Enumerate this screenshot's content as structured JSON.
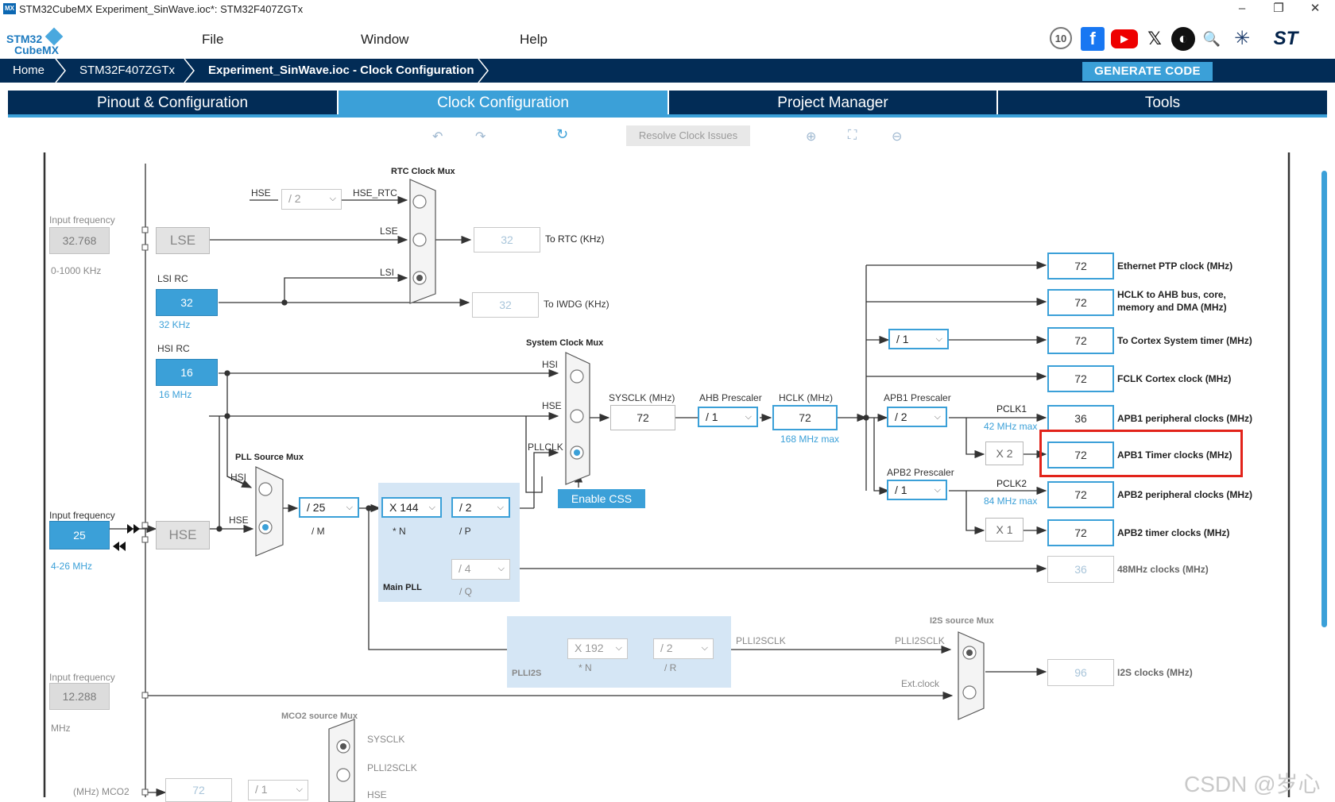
{
  "window": {
    "title": "STM32CubeMX Experiment_SinWave.ioc*: STM32F407ZGTx",
    "app_icon_text": "MX",
    "controls": [
      "–",
      "❐",
      "✕"
    ]
  },
  "logo": {
    "line1": "STM32",
    "line2": "CubeMX"
  },
  "menu": {
    "file": "File",
    "window": "Window",
    "help": "Help"
  },
  "social_icons": [
    "anniversary-10-icon",
    "facebook-icon",
    "youtube-icon",
    "x-icon",
    "github-icon",
    "search-icon",
    "network-icon",
    "st-logo-icon"
  ],
  "social": {
    "anniv": "10",
    "facebook": "f",
    "youtube": "▶",
    "x": "𝕏",
    "github": "◐",
    "search": "🔍",
    "network": "✳",
    "st": "ST"
  },
  "breadcrumb": {
    "home": "Home",
    "mcu": "STM32F407ZGTx",
    "page": "Experiment_SinWave.ioc - Clock Configuration"
  },
  "generate_code": "GENERATE CODE",
  "tabs": [
    {
      "label": "Pinout & Configuration"
    },
    {
      "label": "Clock Configuration"
    },
    {
      "label": "Project Manager"
    },
    {
      "label": "Tools"
    }
  ],
  "toolbar": {
    "undo": "↶",
    "redo": "↷",
    "refresh": "↻",
    "resolve": "Resolve Clock Issues",
    "zoom_in": "⊕",
    "fit": "⛶",
    "zoom_out": "⊖"
  },
  "diagram": {
    "lse_input": {
      "label": "Input frequency",
      "value": "32.768",
      "range": "0-1000 KHz",
      "osc": "LSE"
    },
    "lsi": {
      "label": "LSI RC",
      "value": "32",
      "unit": "32 KHz"
    },
    "hsi": {
      "label": "HSI RC",
      "value": "16",
      "unit": "16 MHz"
    },
    "hse_input": {
      "label": "Input frequency",
      "value": "25",
      "range": "4-26 MHz",
      "osc": "HSE"
    },
    "ext_input": {
      "label": "Input frequency",
      "value": "12.288",
      "unit": "MHz"
    },
    "rtc_mux": {
      "title": "RTC Clock Mux",
      "hse": "HSE",
      "div": "/ 2",
      "hse_rtc": "HSE_RTC",
      "lse": "LSE",
      "lsi": "LSI",
      "to_rtc_value": "32",
      "to_rtc": "To RTC (KHz)",
      "to_iwdg_value": "32",
      "to_iwdg": "To IWDG (KHz)"
    },
    "sys_mux": {
      "title": "System Clock Mux",
      "hsi": "HSI",
      "hse": "HSE",
      "pllclk": "PLLCLK"
    },
    "pll_src_mux": {
      "title": "PLL Source Mux",
      "hsi": "HSI",
      "hse": "HSE"
    },
    "pll": {
      "m": "/ 25",
      "m_label": "/ M",
      "n": "X 144",
      "n_label": "* N",
      "p": "/ 2",
      "p_label": "/ P",
      "q": "/ 4",
      "q_label": "/ Q",
      "title": "Main PLL"
    },
    "enable_css": "Enable CSS",
    "sysclk": {
      "label": "SYSCLK (MHz)",
      "value": "72"
    },
    "ahb": {
      "label": "AHB Prescaler",
      "value": "/ 1"
    },
    "hclk": {
      "label": "HCLK (MHz)",
      "value": "72",
      "max": "168 MHz max"
    },
    "cortex_div": "/ 1",
    "apb1": {
      "label": "APB1 Prescaler",
      "value": "/ 2",
      "pclk": "PCLK1",
      "max": "42 MHz max",
      "mult": "X 2"
    },
    "apb2": {
      "label": "APB2 Prescaler",
      "value": "/ 1",
      "pclk": "PCLK2",
      "max": "84 MHz max",
      "mult": "X 1"
    },
    "outputs": [
      {
        "value": "72",
        "label": "Ethernet PTP clock (MHz)"
      },
      {
        "value": "72",
        "label": "HCLK to AHB bus, core,"
      },
      {
        "value": "72",
        "label": "To Cortex System timer (MHz)"
      },
      {
        "value": "72",
        "label": "FCLK Cortex clock (MHz)"
      },
      {
        "value": "36",
        "label": "APB1 peripheral clocks (MHz)"
      },
      {
        "value": "72",
        "label": "APB1 Timer clocks (MHz)"
      },
      {
        "value": "72",
        "label": "APB2 peripheral clocks (MHz)"
      },
      {
        "value": "72",
        "label": "APB2 timer clocks (MHz)"
      },
      {
        "value": "36",
        "label": "48MHz clocks (MHz)"
      },
      {
        "value": "96",
        "label": "I2S clocks (MHz)"
      }
    ],
    "hclk_label_line2": "memory and DMA (MHz)",
    "plli2s": {
      "n": "X 192",
      "n_label": "* N",
      "r": "/ 2",
      "r_label": "/ R",
      "title": "PLLI2S",
      "out": "PLLI2SCLK"
    },
    "i2s_mux": {
      "title": "I2S source Mux",
      "in1": "PLLI2SCLK",
      "in2": "Ext.clock"
    },
    "mco2": {
      "title": "MCO2 source Mux",
      "sysclk": "SYSCLK",
      "plli2s": "PLLI2SCLK",
      "hse": "HSE",
      "label": "(MHz) MCO2",
      "value": "72",
      "div": "/ 1"
    }
  },
  "watermark": "CSDN @岁心",
  "colors": {
    "navy": "#022c56",
    "accent": "#3ba0d8",
    "highlight": "#e2231a"
  }
}
